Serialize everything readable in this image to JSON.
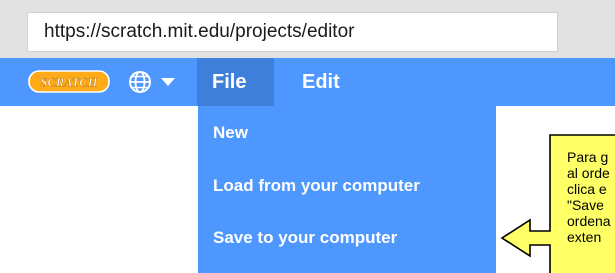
{
  "browser": {
    "url": "https://scratch.mit.edu/projects/editor"
  },
  "menubar": {
    "logo_text": "SCRATCH",
    "language_icon": "globe-icon",
    "file_label": "File",
    "edit_label": "Edit"
  },
  "file_menu": {
    "items": [
      {
        "label": "New"
      },
      {
        "label": "Load from your computer"
      },
      {
        "label": "Save to your computer"
      }
    ]
  },
  "callout": {
    "lines": [
      "Para g",
      "al orde",
      "clica e",
      "\"Save",
      "ordena",
      "exten"
    ]
  },
  "colors": {
    "menubar": "#4d97ff",
    "menu_active": "#3d7fd9",
    "logo": "#ffab19",
    "callout_bg": "#ffff66"
  }
}
